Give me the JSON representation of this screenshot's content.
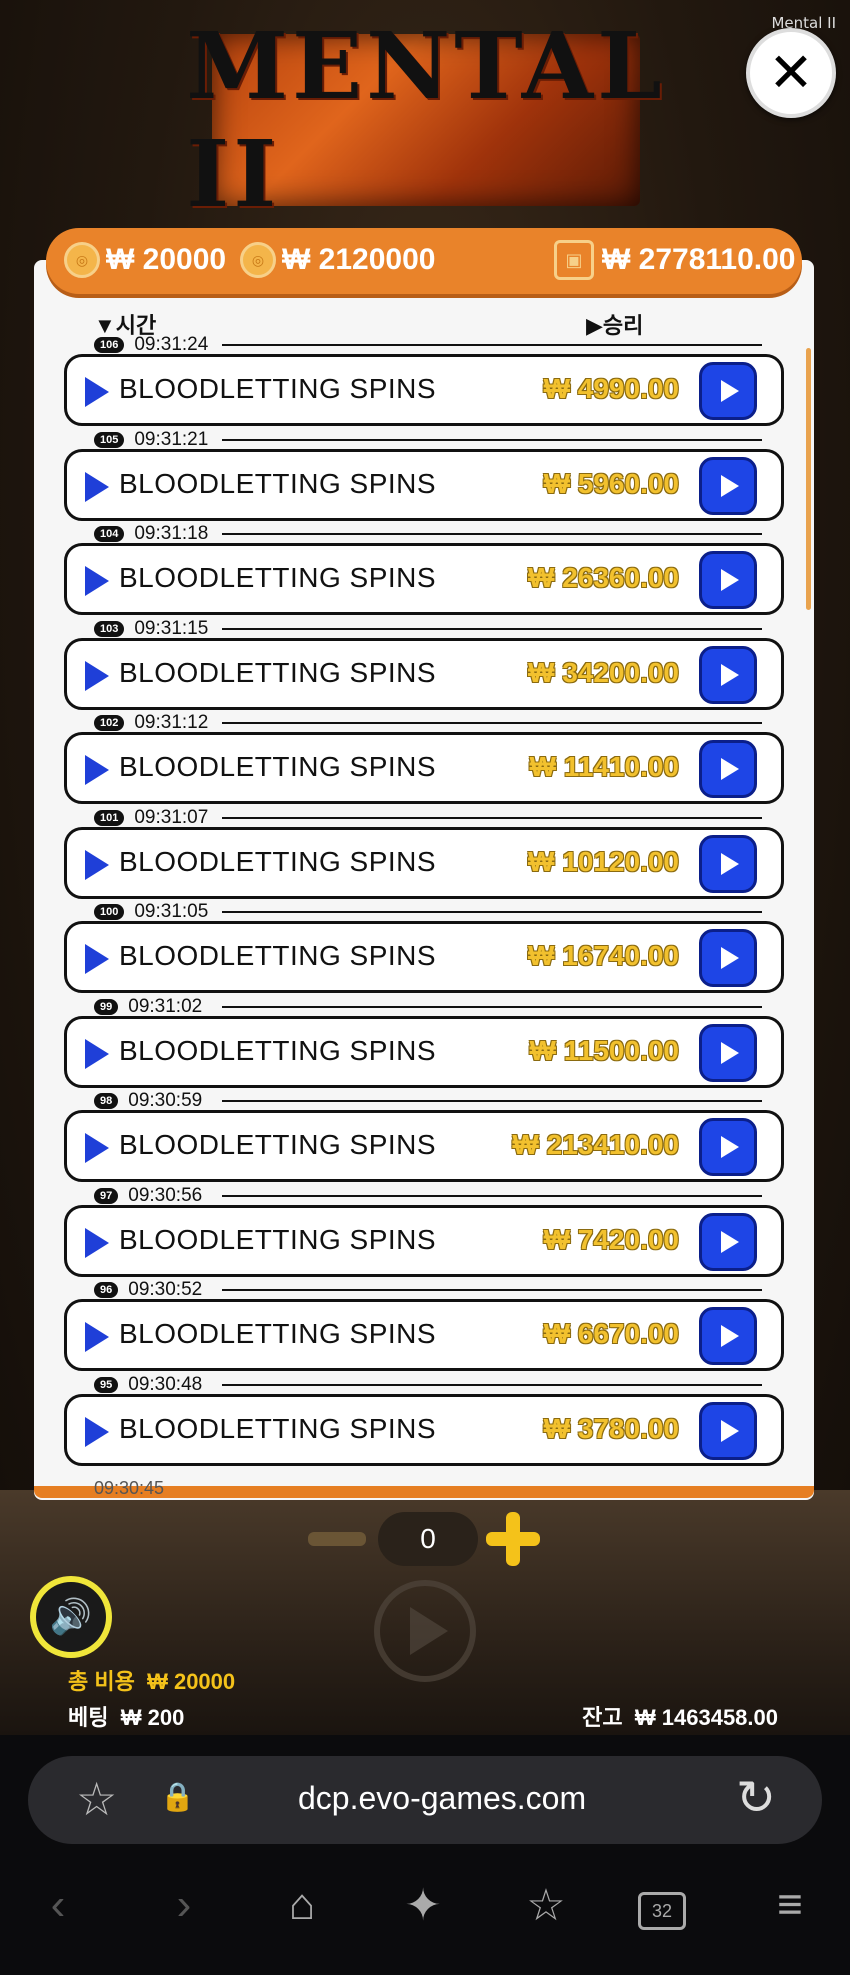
{
  "window_title": "Mental II",
  "logo_text": "MENTAL II",
  "balances": {
    "bet_amount": "₩ 20000",
    "total_win": "₩ 2120000",
    "wallet": "₩ 2778110.00"
  },
  "columns": {
    "time": "시간",
    "win": "승리"
  },
  "rows": [
    {
      "id": "106",
      "time": "09:31:24",
      "name": "BLOODLETTING SPINS",
      "amount": "₩ 4990.00"
    },
    {
      "id": "105",
      "time": "09:31:21",
      "name": "BLOODLETTING SPINS",
      "amount": "₩ 5960.00"
    },
    {
      "id": "104",
      "time": "09:31:18",
      "name": "BLOODLETTING SPINS",
      "amount": "₩ 26360.00"
    },
    {
      "id": "103",
      "time": "09:31:15",
      "name": "BLOODLETTING SPINS",
      "amount": "₩ 34200.00"
    },
    {
      "id": "102",
      "time": "09:31:12",
      "name": "BLOODLETTING SPINS",
      "amount": "₩ 11410.00"
    },
    {
      "id": "101",
      "time": "09:31:07",
      "name": "BLOODLETTING SPINS",
      "amount": "₩ 10120.00"
    },
    {
      "id": "100",
      "time": "09:31:05",
      "name": "BLOODLETTING SPINS",
      "amount": "₩ 16740.00"
    },
    {
      "id": "99",
      "time": "09:31:02",
      "name": "BLOODLETTING SPINS",
      "amount": "₩ 11500.00"
    },
    {
      "id": "98",
      "time": "09:30:59",
      "name": "BLOODLETTING SPINS",
      "amount": "₩ 213410.00"
    },
    {
      "id": "97",
      "time": "09:30:56",
      "name": "BLOODLETTING SPINS",
      "amount": "₩ 7420.00"
    },
    {
      "id": "96",
      "time": "09:30:52",
      "name": "BLOODLETTING SPINS",
      "amount": "₩ 6670.00"
    },
    {
      "id": "95",
      "time": "09:30:48",
      "name": "BLOODLETTING SPINS",
      "amount": "₩ 3780.00"
    }
  ],
  "partial_row_time": "09:30:45",
  "stepper_value": "0",
  "footer": {
    "total_cost_label": "총 비용",
    "total_cost_value": "₩ 20000",
    "bet_label": "베팅",
    "bet_value": "₩ 200",
    "balance_label": "잔고",
    "balance_value": "₩ 1463458.00"
  },
  "browser": {
    "url": "dcp.evo-games.com",
    "tab_count": "32"
  },
  "icons": {
    "close": "close-icon",
    "sound": "speaker-icon",
    "favorite": "star-icon",
    "lock": "lock-icon",
    "reload": "reload-icon"
  },
  "colors": {
    "accent": "#e9832a",
    "row_play": "#1e45e6",
    "win_amount": "#f2c12e",
    "sound": "#f0e63a"
  }
}
